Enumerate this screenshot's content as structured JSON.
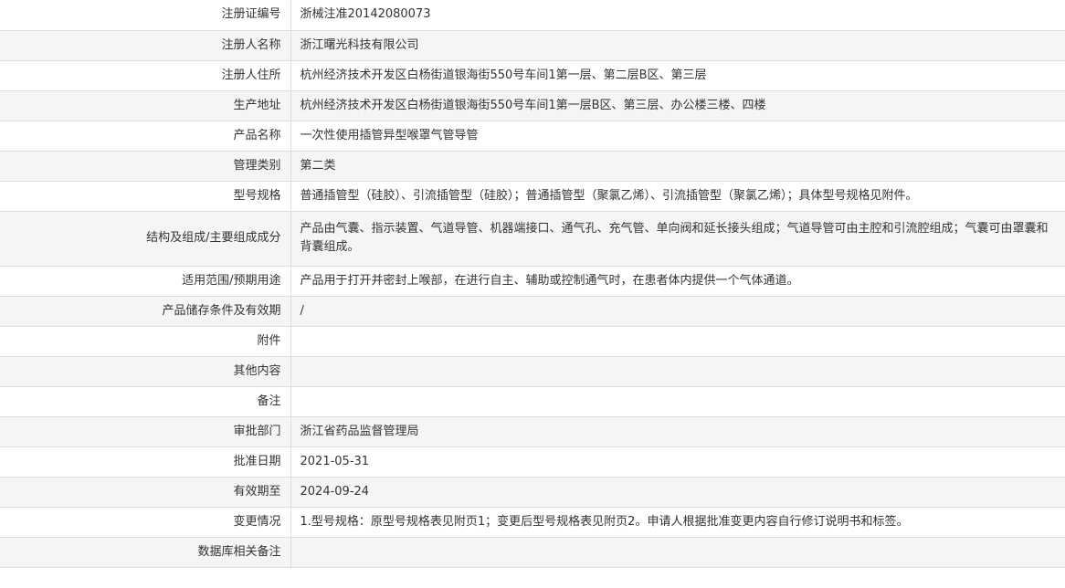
{
  "rows": [
    {
      "label": "注册证编号",
      "value": "浙械注准20142080073"
    },
    {
      "label": "注册人名称",
      "value": "浙江曙光科技有限公司"
    },
    {
      "label": "注册人住所",
      "value": "杭州经济技术开发区白杨街道银海街550号车间1第一层、第二层B区、第三层"
    },
    {
      "label": "生产地址",
      "value": "杭州经济技术开发区白杨街道银海街550号车间1第一层B区、第三层、办公楼三楼、四楼"
    },
    {
      "label": "产品名称",
      "value": "一次性使用插管异型喉罩气管导管"
    },
    {
      "label": "管理类别",
      "value": "第二类"
    },
    {
      "label": "型号规格",
      "value": "普通插管型（硅胶）、引流插管型（硅胶）；普通插管型（聚氯乙烯）、引流插管型（聚氯乙烯）；具体型号规格见附件。"
    },
    {
      "label": "结构及组成/主要组成成分",
      "value": "产品由气囊、指示装置、气道导管、机器端接口、通气孔、充气管、单向阀和延长接头组成；气道导管可由主腔和引流腔组成；气囊可由罩囊和背囊组成。"
    },
    {
      "label": "适用范围/预期用途",
      "value": "产品用于打开并密封上喉部，在进行自主、辅助或控制通气时，在患者体内提供一个气体通道。"
    },
    {
      "label": "产品储存条件及有效期",
      "value": "/"
    },
    {
      "label": "附件",
      "value": ""
    },
    {
      "label": "其他内容",
      "value": ""
    },
    {
      "label": "备注",
      "value": ""
    },
    {
      "label": "审批部门",
      "value": "浙江省药品监督管理局"
    },
    {
      "label": "批准日期",
      "value": "2021-05-31"
    },
    {
      "label": "有效期至",
      "value": "2024-09-24"
    },
    {
      "label": "变更情况",
      "value": "1.型号规格：原型号规格表见附页1；变更后型号规格表见附页2。申请人根据批准变更内容自行修订说明书和标签。"
    },
    {
      "label": "数据库相关备注",
      "value": ""
    }
  ]
}
